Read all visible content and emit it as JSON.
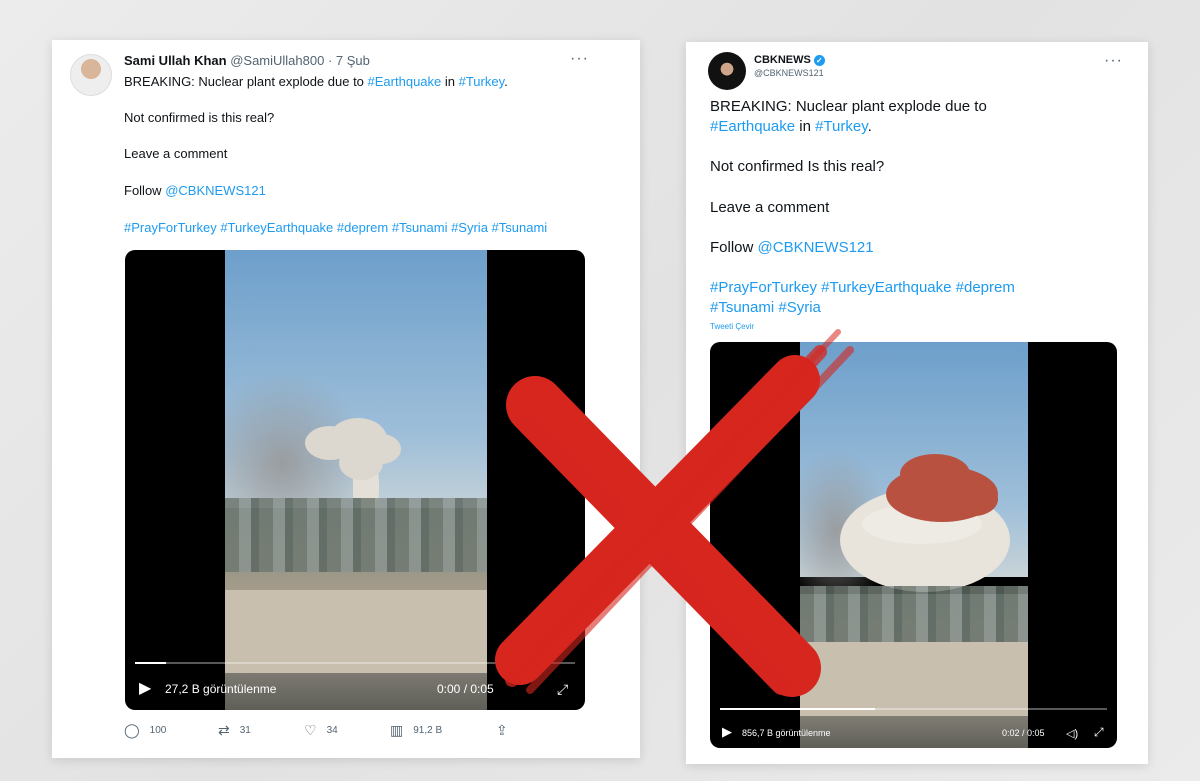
{
  "tweet1": {
    "display_name": "Sami Ullah Khan",
    "handle_time": "@SamiUllah800 · 7 Şub",
    "more": "···",
    "line1_pre": "BREAKING: Nuclear plant explode due to ",
    "line1_tag1": "#Earthquake",
    "line1_mid": " in ",
    "line1_tag2": "#Turkey",
    "line1_end": ".",
    "line2": "Not confirmed is this real?",
    "line3": "Leave a comment",
    "line4_pre": "Follow ",
    "line4_mention": "@CBKNEWS121",
    "hashtags": "#PrayForTurkey #TurkeyEarthquake #deprem #Tsunami #Syria #Tsunami",
    "video": {
      "play": "▶",
      "views": "27,2 B görüntülenme",
      "time": "0:00 / 0:05",
      "fullscreen": "⤢",
      "progress": 0.07
    },
    "actions": {
      "reply_icon": "◯",
      "reply_count": "100",
      "retweet_icon": "⇄",
      "retweet_count": "31",
      "like_icon": "♡",
      "like_count": "34",
      "views_icon": "▥",
      "views_count": "91,2 B",
      "share_icon": "⇪"
    }
  },
  "tweet2": {
    "display_name": "CBKNEWS",
    "verified_icon": "✓",
    "handle": "@CBKNEWS121",
    "more": "···",
    "line1": "BREAKING: Nuclear plant explode due to",
    "line2_tag1": "#Earthquake",
    "line2_mid": " in ",
    "line2_tag2": "#Turkey",
    "line2_end": ".",
    "line3": "Not confirmed Is this real?",
    "line4": "Leave a comment",
    "line5_pre": "Follow ",
    "line5_mention": "@CBKNEWS121",
    "hashtags_line1": "#PrayForTurkey #TurkeyEarthquake #deprem",
    "hashtags_line2": "#Tsunami #Syria",
    "translate": "Tweeti Çevir",
    "video": {
      "play": "▶",
      "views": "856,7 B görüntülenme",
      "time": "0:02 / 0:05",
      "volume": "◁)",
      "fullscreen": "⤢",
      "progress": 0.4
    }
  },
  "colors": {
    "link": "#1d9bf0",
    "muted": "#536471",
    "cross": "#d6261e"
  }
}
